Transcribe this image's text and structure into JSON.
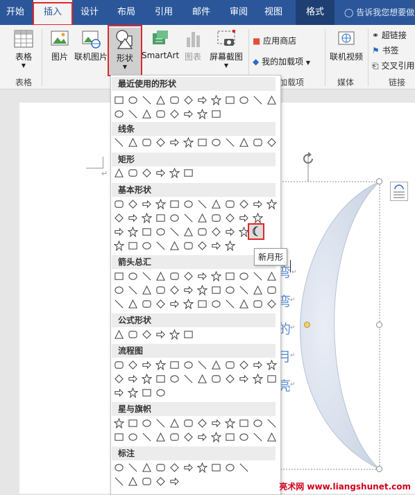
{
  "tabs": [
    {
      "label": "开始"
    },
    {
      "label": "插入"
    },
    {
      "label": "设计"
    },
    {
      "label": "布局"
    },
    {
      "label": "引用"
    },
    {
      "label": "邮件"
    },
    {
      "label": "审阅"
    },
    {
      "label": "视图"
    },
    {
      "label": "格式"
    }
  ],
  "tellme": "告诉我您想要做",
  "ribbon": {
    "table": "表格",
    "picture": "图片",
    "online_picture": "联机图片",
    "shapes": "形状",
    "smartart": "SmartArt",
    "chart": "图表",
    "screenshot": "屏幕截图",
    "store": "应用商店",
    "my_addins": "我的加载项",
    "online_video": "联机视频",
    "hyperlink": "超链接",
    "bookmark": "书签",
    "cross_ref": "交叉引用",
    "groups": {
      "table": "表格",
      "addins": "加载项",
      "media": "媒体",
      "links": "链接"
    }
  },
  "gallery": {
    "recent": "最近使用的形状",
    "lines": "线条",
    "rect": "矩形",
    "basic": "基本形状",
    "arrows": "箭头总汇",
    "equation": "公式形状",
    "flowchart": "流程图",
    "stars": "星与旗帜",
    "callouts": "标注"
  },
  "tooltip": "新月形",
  "vertical_text": [
    "弯",
    "弯",
    "的",
    "月",
    "亮"
  ],
  "footer": "亮术网 www.liangshunet.com"
}
